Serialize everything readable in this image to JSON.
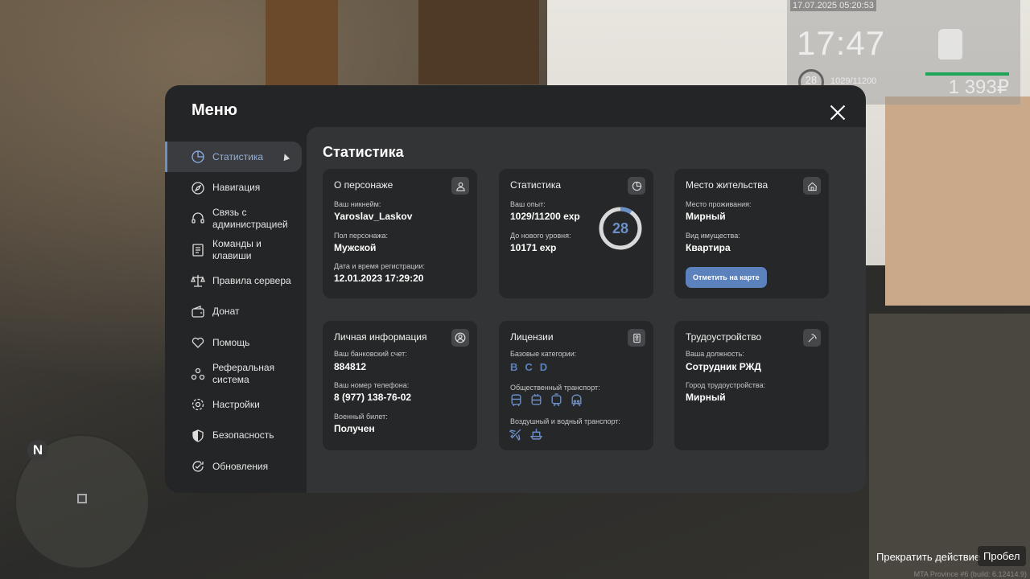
{
  "hud": {
    "datetime": "17.07.2025 05:20:53",
    "time": "17:47",
    "level": "28",
    "exp": "1029/11200",
    "money": "1 393₽"
  },
  "menu": {
    "title": "Меню",
    "sidebar": [
      {
        "label": "Статистика",
        "icon": "pie-chart-icon",
        "active": true
      },
      {
        "label": "Навигация",
        "icon": "compass-icon"
      },
      {
        "label": "Связь с администрацией",
        "icon": "headset-icon"
      },
      {
        "label": "Команды и клавиши",
        "icon": "document-icon"
      },
      {
        "label": "Правила сервера",
        "icon": "scales-icon"
      },
      {
        "label": "Донат",
        "icon": "wallet-icon"
      },
      {
        "label": "Помощь",
        "icon": "heart-hand-icon"
      },
      {
        "label": "Реферальная система",
        "icon": "referral-icon"
      },
      {
        "label": "Настройки",
        "icon": "gear-icon"
      },
      {
        "label": "Безопасность",
        "icon": "shield-icon"
      },
      {
        "label": "Обновления",
        "icon": "refresh-check-icon"
      }
    ],
    "content_title": "Статистика"
  },
  "cards": {
    "character": {
      "title": "О персонаже",
      "nickname_label": "Ваш никнейм:",
      "nickname": "Yaroslav_Laskov",
      "gender_label": "Пол персонажа:",
      "gender": "Мужской",
      "reg_label": "Дата и время регистрации:",
      "reg": "12.01.2023 17:29:20"
    },
    "stats": {
      "title": "Статистика",
      "exp_label": "Ваш опыт:",
      "exp": "1029/11200 exp",
      "next_label": "До нового уровня:",
      "next": "10171 exp",
      "level": "28",
      "progress": 0.092
    },
    "residence": {
      "title": "Место жительства",
      "place_label": "Место проживания:",
      "place": "Мирный",
      "property_label": "Вид имущества:",
      "property": "Квартира",
      "button": "Отметить на карте"
    },
    "personal": {
      "title": "Личная информация",
      "bank_label": "Ваш банковский счет:",
      "bank": "884812",
      "phone_label": "Ваш номер телефона:",
      "phone": "8 (977) 138-76-02",
      "military_label": "Военный билет:",
      "military": "Получен"
    },
    "licenses": {
      "title": "Лицензии",
      "basic_label": "Базовые категории:",
      "basic": [
        "B",
        "C",
        "D"
      ],
      "public_label": "Общественный транспорт:",
      "public_icons": [
        "bus-icon",
        "trolleybus-icon",
        "tram-icon",
        "train-icon"
      ],
      "air_label": "Воздушный и водный транспорт:",
      "air_icons": [
        "plane-icon",
        "boat-icon"
      ]
    },
    "employment": {
      "title": "Трудоустройство",
      "position_label": "Ваша должность:",
      "position": "Сотрудник РЖД",
      "city_label": "Город трудоустройства:",
      "city": "Мирный"
    }
  },
  "hints": {
    "action": "Прекратить действие",
    "key": "Пробел"
  },
  "build": "MTA Province #6 (build: 6.12414.9)",
  "colors": {
    "accent": "#6b8fc7",
    "button": "#5b82bd",
    "panel": "#242526",
    "content": "#333436",
    "card": "#262728"
  }
}
